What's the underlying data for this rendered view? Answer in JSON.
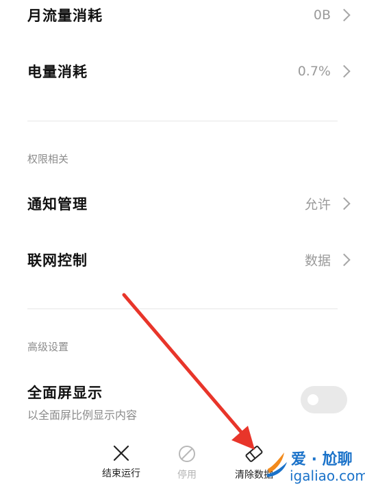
{
  "rows": {
    "monthly_traffic": {
      "label": "月流量消耗",
      "value": "0B"
    },
    "battery": {
      "label": "电量消耗",
      "value": "0.7%"
    }
  },
  "permissions": {
    "title": "权限相关",
    "notification": {
      "label": "通知管理",
      "value": "允许"
    },
    "network": {
      "label": "联网控制",
      "value": "数据"
    }
  },
  "advanced": {
    "title": "高级设置",
    "fullscreen": {
      "label": "全面屏显示",
      "sublabel": "以全面屏比例显示内容",
      "enabled": false
    }
  },
  "bottom_bar": {
    "force_stop": "结束运行",
    "disable": "停用",
    "clear_data": "清除数据"
  },
  "watermark": {
    "brand": "爱 · 尬聊",
    "url": "igaliao.com"
  },
  "colors": {
    "annotation_arrow": "#e8352a",
    "watermark": "#1a72c9"
  }
}
